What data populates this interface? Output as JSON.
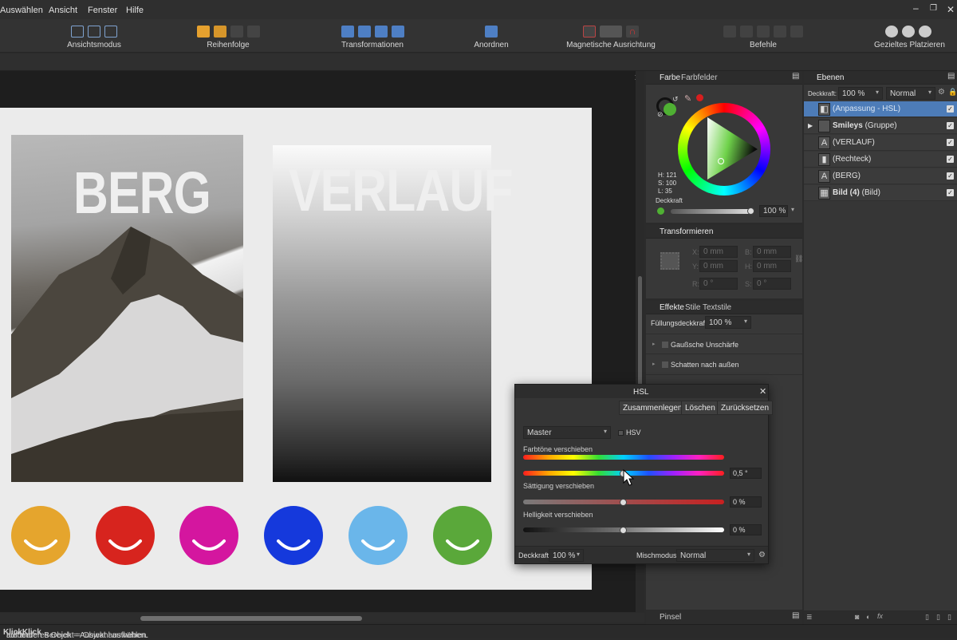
{
  "menu": {
    "items": [
      "Auswählen",
      "Ansicht",
      "Fenster",
      "Hilfe"
    ]
  },
  "toolbar": {
    "groups": [
      {
        "label": "Ansichtsmodus"
      },
      {
        "label": "Reihenfolge"
      },
      {
        "label": "Transformationen"
      },
      {
        "label": "Anordnen"
      },
      {
        "label": "Magnetische Ausrichtung"
      },
      {
        "label": "Befehle"
      },
      {
        "label": "Gezieltes Platzieren"
      }
    ]
  },
  "canvas": {
    "words": {
      "left": "BERG",
      "right": "VERLAUF"
    },
    "smileys": [
      {
        "color": "#e5a52d"
      },
      {
        "color": "#d7241e"
      },
      {
        "color": "#d4169f"
      },
      {
        "color": "#1539dc"
      },
      {
        "color": "#6ab6ea"
      },
      {
        "color": "#5aa83a"
      }
    ]
  },
  "status": {
    "part1": "hieben. ",
    "bold1": "Klick",
    "part2": " auf anderes Objekt = Objekt auswählen. ",
    "bold2": "Klick",
    "part3": " auf leeren Bereich = Auswahl aufheben."
  },
  "color_panel": {
    "tabs": [
      "Farbe",
      "Farbfelder"
    ],
    "h": "H: 121",
    "s": "S: 100",
    "l": "L: 35",
    "opacity_label": "Deckkraft",
    "opacity_value": "100 %",
    "opacity": 1.0,
    "primary_color": "#4fb033",
    "secondary_color": "#d71e1e"
  },
  "transform_panel": {
    "title": "Transformieren",
    "fields": {
      "x_label": "X:",
      "x": "0 mm",
      "y_label": "Y:",
      "y": "0 mm",
      "w_label": "B:",
      "w": "0 mm",
      "h_label": "H:",
      "h": "0 mm",
      "r_label": "R:",
      "r": "0 °",
      "s_label": "S:",
      "s": "0 °"
    }
  },
  "effects_panel": {
    "tabs": [
      "Effekte",
      "Stile",
      "Textstile"
    ],
    "fill_opacity_label": "Füllungsdeckkraft:",
    "fill_opacity_value": "100 %",
    "items": [
      "Gaußsche Unschärfe",
      "Schatten nach außen"
    ]
  },
  "brush_panel": {
    "title": "Pinsel"
  },
  "layers_panel": {
    "tab": "Ebenen",
    "opacity_label": "Deckkraft:",
    "opacity_value": "100 %",
    "blend_value": "Normal",
    "layers": [
      {
        "name": "(Anpassung - HSL)",
        "bold": "",
        "suffix": "",
        "selected": true
      },
      {
        "name": "",
        "bold": "Smileys",
        "suffix": " (Gruppe)",
        "selected": false
      },
      {
        "name": "(VERLAUF)",
        "bold": "",
        "suffix": "",
        "selected": false
      },
      {
        "name": "(Rechteck)",
        "bold": "",
        "suffix": "",
        "selected": false
      },
      {
        "name": "(BERG)",
        "bold": "",
        "suffix": "",
        "selected": false
      },
      {
        "name": "",
        "bold": "Bild (4)",
        "suffix": " (Bild)",
        "selected": false
      }
    ]
  },
  "hsl_dialog": {
    "title": "HSL",
    "merge": "Zusammenlegen",
    "delete": "Löschen",
    "reset": "Zurücksetzen",
    "preset": "Master",
    "hsv_label": "HSV",
    "hue_label": "Farbtöne verschieben",
    "hue_value": "0,5 °",
    "hue_shift": 0.5,
    "saturation_label": "Sättigung verschieben",
    "saturation_value": "0 %",
    "saturation_shift": 0,
    "lightness_label": "Helligkeit verschieben",
    "lightness_value": "0 %",
    "lightness_shift": 0,
    "opacity_label": "Deckkraft:",
    "opacity_value": "100 %",
    "blend_label": "Mischmodus:",
    "blend_value": "Normal"
  }
}
